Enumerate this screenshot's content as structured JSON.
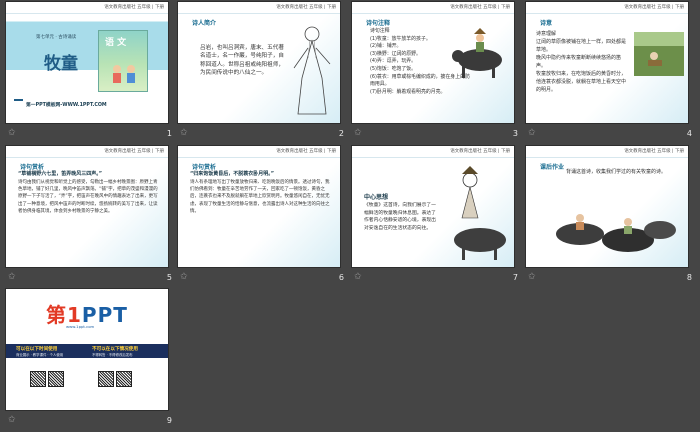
{
  "publisher_line": "语文教育出版社 五年级 | 下册",
  "slides": [
    {
      "number": "1",
      "unit": "第七单元 · 古诗诵读",
      "title": "牧童",
      "book_label": "语 文",
      "footer": "第一PPT模板网-WWW.1PPT.COM"
    },
    {
      "number": "2",
      "tag": "诗人简介",
      "text": "吕岩，也叫吕洞宾，唐末、五代著名道士，名一作巖，号纯阳子，自称回道人。世称吕祖或纯阳祖师，为民间传说中的八仙之一。"
    },
    {
      "number": "3",
      "tag": "诗句注释",
      "lines": [
        "诗句注释",
        "(1)牧童：放牛放羊的孩子。",
        "(2)铺：铺开。",
        "(3)横野：辽阔的原野。",
        "(4)弄：逗弄，玩弄。",
        "(5)饱饭：吃饱了饭。",
        "(6)蓑衣：用草或棕毛编织成的，披在身上的防雨用具。",
        "(7)卧月明：躺着观看明亮的月亮。"
      ]
    },
    {
      "number": "4",
      "tag": "诗意",
      "lines": [
        "诗意理解",
        "辽阔的草原像被铺在地上一样，四处都是草地。",
        "晚风中隐约传来牧童断断续续悠扬的笛声。",
        "牧童放牧归来，在吃饱饭后的黄昏时分，",
        "他连蓑衣都没脱，就躺在草地上看天空中的明月。"
      ]
    },
    {
      "number": "5",
      "tag": "诗句赏析",
      "lead": "“草铺横野六七里，笛弄晚风三四声。”",
      "text": "诗句由我们从视觉和听觉上的感受，勾勒出一幅乡村晚景图：原野上青色草地，铺了好几里，晚风中笛声飘荡。“铺”字，把草的茂盛和漫漫的原野一下子写活了，“弄”字，把笛声在晚风中的情趣表达了出来，更写出了一种意境，把风中笛声的时断时续，悠扬婉转的美写了出来，让读者仿佛身临其境，体会到乡村晚景的宁静之美。"
    },
    {
      "number": "6",
      "tag": "诗句赏析",
      "lead": "“归来饱饭黄昏后，不脱蓑衣卧月明。”",
      "text": "诗人有条理地写出了牧童放牧归来、吃饱晚饭后的情景。透过诗句，我们仿佛看到：牧童在辛苦地劳作了一天，回家吃了一顿饱饭，黄昏之后，连蓑衣也来不及脱就躺在草地上欣赏明月。牧童悠闲自在，无忧无虑，表现了牧童生活的恬静与惬意，也流露出诗人对这种生活的向往之情。"
    },
    {
      "number": "7",
      "tag": "中心思想",
      "text": "《牧童》这首诗，向我们展示了一幅鲜活的牧童晚归休息图。表达了作者内心恬静安适的心境，表现出对安逸自在的生活状态的向往。"
    },
    {
      "number": "8",
      "tag": "课后作业",
      "text": "背诵这首诗，收集我们学过的有关牧童的诗。"
    },
    {
      "number": "9",
      "logo_first": "第1",
      "logo_rest": "PPT",
      "logo_sub": "www.1ppt.com",
      "left_caption": "可以在以下时间使用",
      "right_caption": "不可以在以下情况使用",
      "left_sub": "商业展示 · 教学课件 · 个人使用",
      "right_sub": "不得转售 · 不得修改后发布"
    }
  ]
}
